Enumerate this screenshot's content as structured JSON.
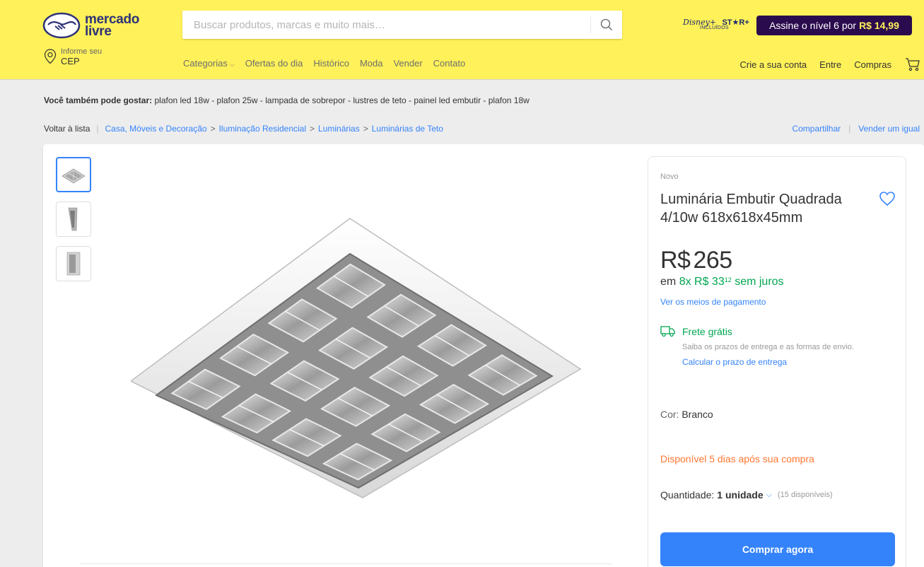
{
  "header": {
    "logo": {
      "line1": "mercado",
      "line2": "livre"
    },
    "search": {
      "placeholder": "Buscar produtos, marcas e muito mais…"
    },
    "disney": {
      "brand": "Disney+",
      "star": "ST★R+",
      "sub": "INCLUÍDOS"
    },
    "promo": {
      "text": "Assine o nível 6 por",
      "price": "R$ 14,99"
    },
    "cep": {
      "line1": "Informe seu",
      "line2": "CEP"
    },
    "nav": [
      "Categorias",
      "Ofertas do dia",
      "Histórico",
      "Moda",
      "Vender",
      "Contato"
    ],
    "account": [
      "Crie a sua conta",
      "Entre",
      "Compras"
    ]
  },
  "also_like": {
    "label": "Você também pode gostar:",
    "items": "plafon led 18w - plafon 25w - lampada de sobrepor - lustres de teto - painel led embutir - plafon 18w"
  },
  "breadcrumb": {
    "back": "Voltar à lista",
    "items": [
      "Casa, Móveis e Decoração",
      "Iluminação Residencial",
      "Luminárias",
      "Luminárias de Teto"
    ]
  },
  "actions": {
    "share": "Compartilhar",
    "sell": "Vender um igual"
  },
  "product": {
    "condition": "Novo",
    "title": "Luminária Embutir Quadrada 4/10w 618x618x45mm",
    "price_currency": "R$",
    "price_value": "265",
    "install_prefix": "em",
    "install_main": "8x R$ 33",
    "install_cents": "12",
    "install_suffix": "sem juros",
    "payment_link": "Ver os meios de pagamento",
    "shipping_title": "Frete grátis",
    "shipping_desc": "Saiba os prazos de entrega e as formas de envio.",
    "shipping_link": "Calcular o prazo de entrega",
    "color_label": "Cor:",
    "color_value": "Branco",
    "availability": "Disponível 5 dias após sua compra",
    "qty_label": "Quantidade:",
    "qty_value": "1 unidade",
    "qty_stock": "(15 disponíveis)",
    "buy_label": "Comprar agora"
  },
  "colors": {
    "yellow": "#fff159",
    "blue": "#3483fa",
    "green": "#00a650",
    "orange": "#ff7733",
    "navy": "#2d3277"
  }
}
